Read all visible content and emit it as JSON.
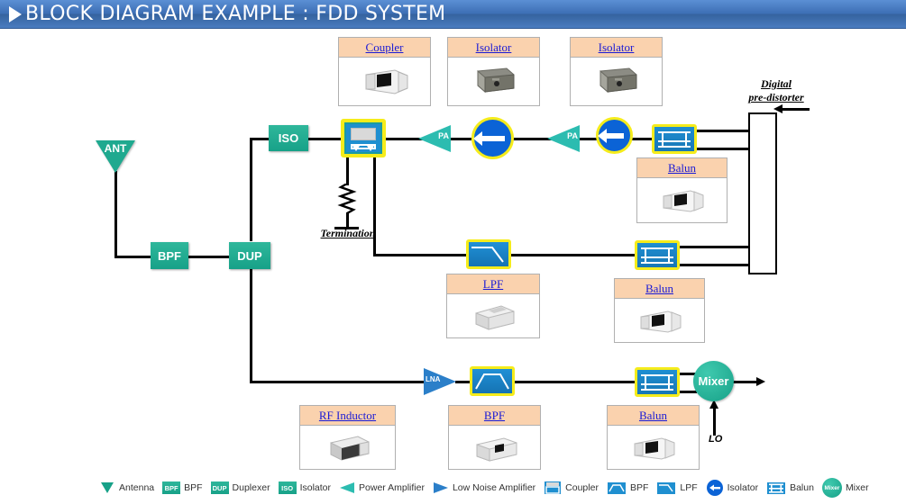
{
  "header": {
    "title": "BLOCK DIAGRAM EXAMPLE : FDD SYSTEM",
    "play_icon": "play-triangle-icon",
    "bg_color": "#3d6fb5",
    "text_color": "#ffffff"
  },
  "colors": {
    "teal": "#17a188",
    "blue": "#1c7fc4",
    "yellow_border": "#f5ec1b",
    "card_header": "#fad2ae",
    "link_text": "#1a1ad6",
    "isolator_blue": "#0b63d6"
  },
  "blocks": {
    "ant": "ANT",
    "bpf": "BPF",
    "dup": "DUP",
    "iso": "ISO",
    "pa1": "PA",
    "pa2": "PA",
    "lna": "LNA",
    "mixer": "Mixer"
  },
  "labels": {
    "termination": "Termination",
    "digital_predistorter_line1": "Digital",
    "digital_predistorter_line2": "pre-distorter",
    "lo": "LO"
  },
  "cards": [
    {
      "title": "Coupler",
      "part": "coupler-smd"
    },
    {
      "title": "Isolator",
      "part": "isolator-smd"
    },
    {
      "title": "Isolator",
      "part": "isolator-smd"
    },
    {
      "title": "Balun",
      "part": "balun-smd"
    },
    {
      "title": "LPF",
      "part": "lpf-smd"
    },
    {
      "title": "Balun",
      "part": "balun-smd"
    },
    {
      "title": "RF Inductor",
      "part": "inductor-smd"
    },
    {
      "title": "BPF",
      "part": "bpf-smd"
    },
    {
      "title": "Balun",
      "part": "balun-smd"
    }
  ],
  "legend": [
    {
      "icon": "antenna-icon",
      "label": "Antenna"
    },
    {
      "icon": "bpf-chip-icon",
      "label": "BPF",
      "chip": "BPF"
    },
    {
      "icon": "duplexer-chip-icon",
      "label": "Duplexer",
      "chip": "DUP"
    },
    {
      "icon": "isolator-chip-icon",
      "label": "Isolator",
      "chip": "ISO"
    },
    {
      "icon": "power-amplifier-icon",
      "label": "Power Amplifier"
    },
    {
      "icon": "low-noise-amplifier-icon",
      "label": "Low Noise Amplifier"
    },
    {
      "icon": "coupler-icon",
      "label": "Coupler"
    },
    {
      "icon": "bpf-icon",
      "label": "BPF"
    },
    {
      "icon": "lpf-icon",
      "label": "LPF"
    },
    {
      "icon": "isolator-icon",
      "label": "Isolator"
    },
    {
      "icon": "balun-icon",
      "label": "Balun"
    },
    {
      "icon": "mixer-icon",
      "label": "Mixer",
      "chip": "Mixer"
    }
  ]
}
